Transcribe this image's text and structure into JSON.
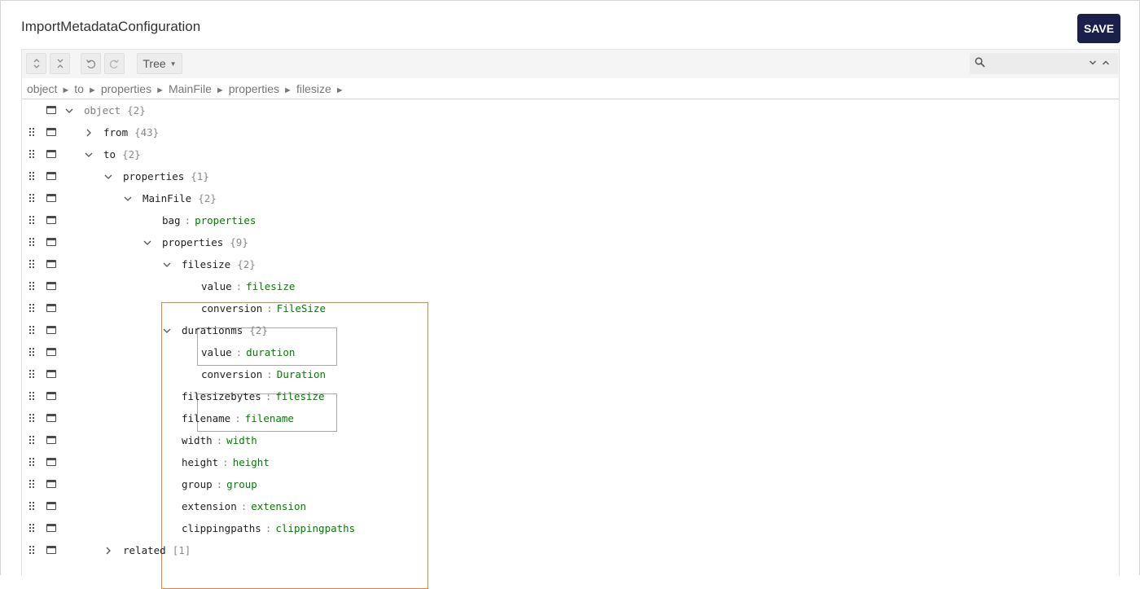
{
  "page": {
    "title": "ImportMetadataConfiguration",
    "save_label": "SAVE"
  },
  "toolbar": {
    "expand_all_icon": "expand-all-icon",
    "collapse_all_icon": "collapse-all-icon",
    "undo_icon": "undo-icon",
    "redo_icon": "redo-icon",
    "mode_label": "Tree",
    "search_placeholder": ""
  },
  "breadcrumb": [
    "object",
    "to",
    "properties",
    "MainFile",
    "properties",
    "filesize"
  ],
  "breadcrumb_separator": "►",
  "tree": [
    {
      "level": 0,
      "key": "object",
      "count": "{2}",
      "expand": "expanded",
      "root": true
    },
    {
      "level": 1,
      "key": "from",
      "count": "{43}",
      "expand": "collapsed"
    },
    {
      "level": 1,
      "key": "to ",
      "count": "{2}",
      "expand": "expanded"
    },
    {
      "level": 2,
      "key": "properties",
      "count": "{1}",
      "expand": "expanded"
    },
    {
      "level": 3,
      "key": "MainFile",
      "count": "{2}",
      "expand": "expanded"
    },
    {
      "level": 4,
      "key": "bag",
      "value": "properties"
    },
    {
      "level": 4,
      "key": "properties",
      "count": "{9}",
      "expand": "expanded"
    },
    {
      "level": 5,
      "key": "filesize",
      "count": "{2}",
      "expand": "expanded"
    },
    {
      "level": 6,
      "key": "value",
      "value": "filesize"
    },
    {
      "level": 6,
      "key": "conversion",
      "value": "FileSize"
    },
    {
      "level": 5,
      "key": "durationms",
      "count": "{2}",
      "expand": "expanded"
    },
    {
      "level": 6,
      "key": "value",
      "value": "duration"
    },
    {
      "level": 6,
      "key": "conversion",
      "value": "Duration"
    },
    {
      "level": 5,
      "key": "filesizebytes",
      "value": "filesize"
    },
    {
      "level": 5,
      "key": "filename",
      "value": "filename"
    },
    {
      "level": 5,
      "key": "width",
      "value": "width"
    },
    {
      "level": 5,
      "key": "height",
      "value": "height"
    },
    {
      "level": 5,
      "key": "group",
      "value": "group"
    },
    {
      "level": 5,
      "key": "extension",
      "value": "extension"
    },
    {
      "level": 5,
      "key": "clippingpaths",
      "value": "clippingpaths"
    },
    {
      "level": 2,
      "key": "related",
      "count": "[1]",
      "expand": "collapsed"
    }
  ],
  "colors": {
    "save_bg": "#1b1f4b",
    "value_text": "#008000",
    "highlight_orange": "#e8813c",
    "highlight_gray": "#a8a8a8"
  }
}
